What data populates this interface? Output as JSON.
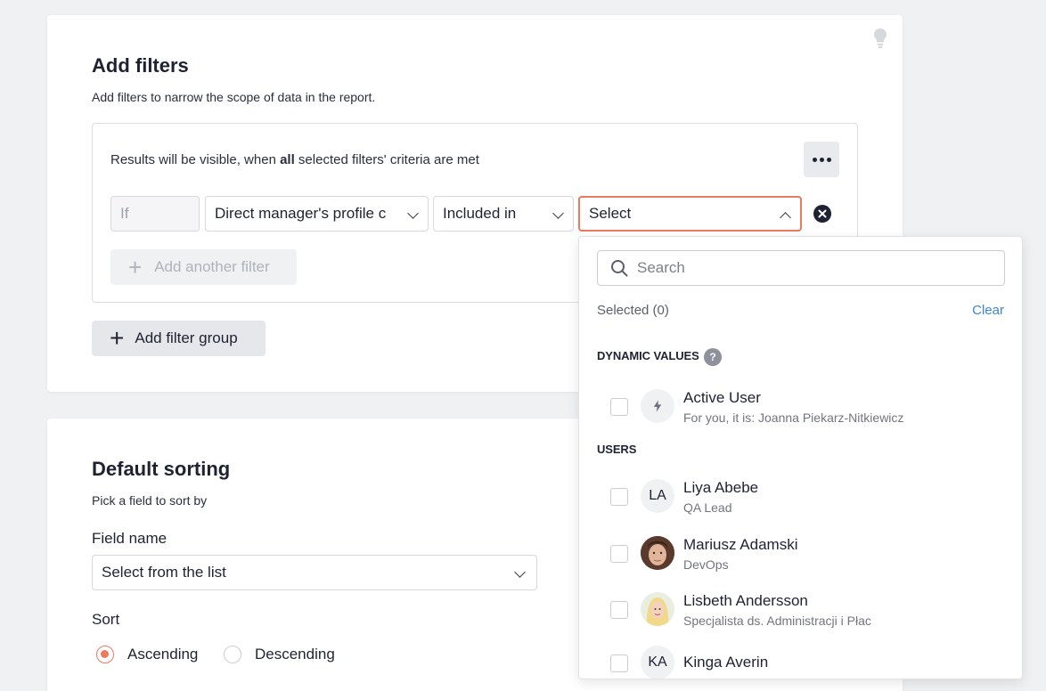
{
  "filters": {
    "title": "Add filters",
    "description": "Add filters to narrow the scope of data in the report.",
    "rule_prefix": "Results will be visible, when ",
    "rule_bold": "all",
    "rule_suffix": " selected filters' criteria are met",
    "row": {
      "if_label": "If",
      "field_value": "Direct manager's profile c",
      "operator_value": "Included in",
      "value_placeholder": "Select"
    },
    "add_another_label": "Add another filter",
    "add_group_label": "Add filter group"
  },
  "sorting": {
    "title": "Default sorting",
    "description": "Pick a field to sort by",
    "field_label": "Field name",
    "field_value": "Select from the list",
    "sort_label": "Sort",
    "ascending_label": "Ascending",
    "descending_label": "Descending",
    "selected": "Ascending"
  },
  "dropdown": {
    "search_placeholder": "Search",
    "selected_label": "Selected (0)",
    "clear_label": "Clear",
    "dynamic_header": "DYNAMIC VALUES",
    "dynamic": [
      {
        "name": "Active User",
        "sub": "For you, it is: Joanna Piekarz-Nitkiewicz"
      }
    ],
    "users_header": "USERS",
    "users": [
      {
        "initials": "LA",
        "name": "Liya Abebe",
        "sub": "QA Lead"
      },
      {
        "initials": "",
        "name": "Mariusz Adamski",
        "sub": "DevOps"
      },
      {
        "initials": "",
        "name": "Lisbeth Andersson",
        "sub": "Specjalista ds. Administracji i Płac"
      },
      {
        "initials": "KA",
        "name": "Kinga Averin",
        "sub": ""
      }
    ]
  },
  "colors": {
    "accent": "#ec7a5f",
    "link": "#3b87d6",
    "text": "#1f2233"
  }
}
